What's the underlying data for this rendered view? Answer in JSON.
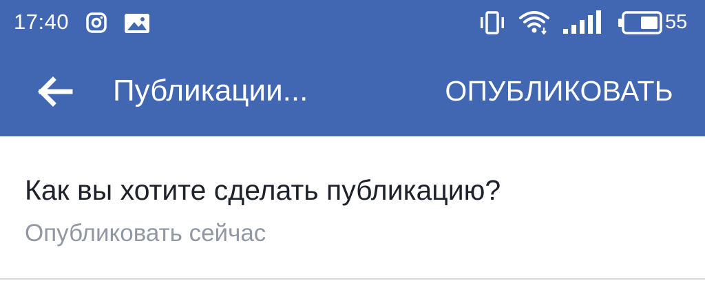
{
  "colors": {
    "header_bg": "#4267b2",
    "header_text": "#ffffff",
    "title_text": "#1d2129",
    "secondary_text": "#9197a3",
    "divider": "#d6d8dc"
  },
  "status_bar": {
    "time": "17:40",
    "left_icons": [
      "instagram-icon",
      "image-notification-icon"
    ],
    "right_icons": [
      "vibrate-icon",
      "wifi-icon",
      "signal-icon",
      "battery-icon"
    ],
    "battery_level": "55"
  },
  "app_bar": {
    "back_icon": "arrow-left-icon",
    "title": "Публикации...",
    "action_label": "ОПУБЛИКОВАТЬ"
  },
  "publish_option": {
    "title": "Как вы хотите сделать публикацию?",
    "value": "Опубликовать сейчас"
  }
}
